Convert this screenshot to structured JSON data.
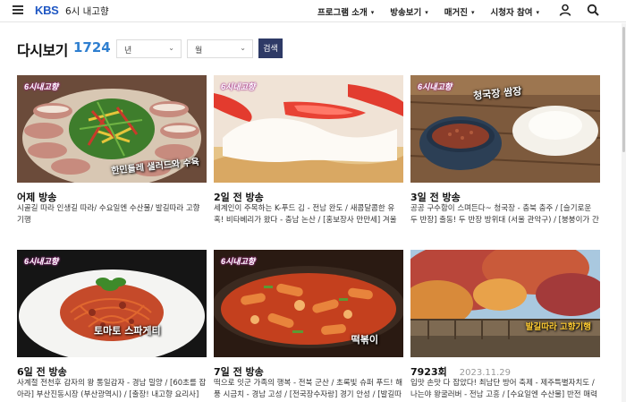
{
  "header": {
    "logo": "KBS",
    "program_title": "6시 내고향",
    "nav": [
      {
        "label": "프로그램 소개"
      },
      {
        "label": "방송보기"
      },
      {
        "label": "매거진"
      },
      {
        "label": "시청자 참여"
      }
    ],
    "caret": "▾",
    "icons": [
      "menu-icon",
      "user-icon",
      "search-icon"
    ]
  },
  "title": {
    "text": "다시보기",
    "count": "1724"
  },
  "filters": {
    "year_label": "년",
    "month_label": "월",
    "search_label": "검색",
    "chevron": "⌄"
  },
  "colors": {
    "accent": "#2f7fd0",
    "button": "#2e3a66",
    "brand": "#1f57c3"
  },
  "badge": {
    "logo": "6시내고향"
  },
  "episodes": [
    {
      "title": "어제 방송",
      "date": "",
      "desc": "시골길 따라 인생길 따라/ 수요일엔 수산물/ 발길따라 고향기행",
      "caption": "한민들레 샐러드와 수육"
    },
    {
      "title": "2일 전 방송",
      "date": "",
      "desc": "세계인이 주목하는 K-푸드 김 - 전남 완도 / 새콤달콤한 유혹! 비타베리가 왔다 - 충남 논산 / [홍보장사 만만세] 겨울이 반가운...",
      "caption": ""
    },
    {
      "title": "3일 전 방송",
      "date": "",
      "desc": "공공 구수함이 스며든다~ 청국장 - 충북 충주 / [슬기로운 두 반장] 출동! 두 반장 방위대 (서울 관악구) / [붕붕이가 간다!] 수상한...",
      "caption": "청국장 쌈장"
    },
    {
      "title": "6일 전 방송",
      "date": "",
      "desc": "사계절 전천후 감자의 왕 통일감자 - 경남 밀양 / [60초를 잡아라] 부산진동시장 (부산광역시) / [출장! 내고향 요리사] 우리 마을,...",
      "caption": "토마토 스파게티"
    },
    {
      "title": "7일 전 방송",
      "date": "",
      "desc": "떡으로 잇군 가족의 행복 - 전북 군산 / 초록빛 슈퍼 푸드! 해풍 시금치 - 경남 고성 / [전국장수자랑] 경기 안성 / [발길따라...",
      "caption": "떡볶이"
    },
    {
      "title": "7923회",
      "date": "2023.11.29",
      "desc": "입맛 손맛 다 잡았다! 최남단 방어 축제 - 제주특별자치도 / 나는야 왕굴러버 - 전남 고흥 / [수요일엔 수산물] 반전 매력 꼼치 (충남...",
      "caption": "발길따라 고향기행"
    }
  ]
}
